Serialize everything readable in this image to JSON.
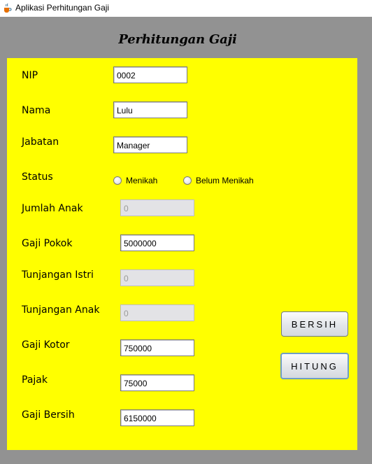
{
  "window": {
    "title": "Aplikasi Perhitungan Gaji",
    "icon": "java-cup-icon"
  },
  "heading": "Perhitungan Gaji",
  "form": {
    "nip": {
      "label": "NIP",
      "value": "0002"
    },
    "nama": {
      "label": "Nama",
      "value": "Lulu"
    },
    "jabatan": {
      "label": "Jabatan",
      "value": "Manager"
    },
    "status": {
      "label": "Status",
      "options": [
        "Menikah",
        "Belum Menikah"
      ],
      "selected": null
    },
    "jumlah_anak": {
      "label": "Jumlah Anak",
      "value": "0",
      "enabled": false
    },
    "gaji_pokok": {
      "label": "Gaji Pokok",
      "value": "5000000"
    },
    "tunjangan_istri": {
      "label": "Tunjangan Istri",
      "value": "0",
      "enabled": false
    },
    "tunjangan_anak": {
      "label": "Tunjangan Anak",
      "value": "0",
      "enabled": false
    },
    "gaji_kotor": {
      "label": "Gaji Kotor",
      "value": "750000"
    },
    "pajak": {
      "label": "Pajak",
      "value": "75000"
    },
    "gaji_bersih": {
      "label": "Gaji Bersih",
      "value": "6150000"
    }
  },
  "buttons": {
    "bersih": "BERSIH",
    "hitung": "HITUNG"
  },
  "colors": {
    "panel": "#ffff00",
    "frame": "#929292"
  }
}
